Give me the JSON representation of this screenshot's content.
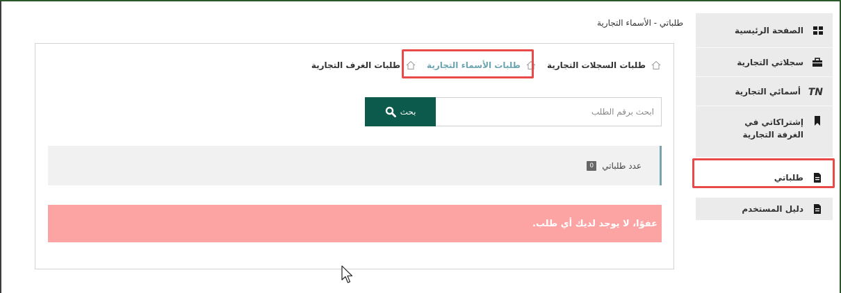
{
  "page_title": "طلباتي - الأسماء التجارية",
  "sidebar": {
    "items": [
      {
        "label": "الصفحة الرئيسية",
        "icon": "grid-icon"
      },
      {
        "label": "سجلاتي التجارية",
        "icon": "briefcase-icon"
      },
      {
        "label": "أسمائي التجارية",
        "icon": "tn-icon",
        "icon_text": "TN"
      },
      {
        "label": "إشتراكاتي في الغرفة التجارية",
        "icon": "bookmark-icon"
      },
      {
        "label": "طلباتي",
        "icon": "document-icon"
      },
      {
        "label": "دليل المستخدم",
        "icon": "document-icon"
      }
    ]
  },
  "tabs": [
    {
      "label": "طلبات السجلات التجارية"
    },
    {
      "label": "طلبات الأسماء التجارية"
    },
    {
      "label": "طلبات الغرف التجارية"
    }
  ],
  "search": {
    "placeholder": "ابحث برقم الطلب",
    "button_label": "بحث"
  },
  "count": {
    "label": "عدد طلباتي",
    "value": "0"
  },
  "alert": {
    "message": "عفوًا، لا يوجد لديك أي طلب."
  },
  "colors": {
    "accent_green": "#0c5a4c",
    "highlight_red": "#e84a4a",
    "alert_bg": "#fca4a4",
    "active_tab": "#6aa4b0"
  }
}
